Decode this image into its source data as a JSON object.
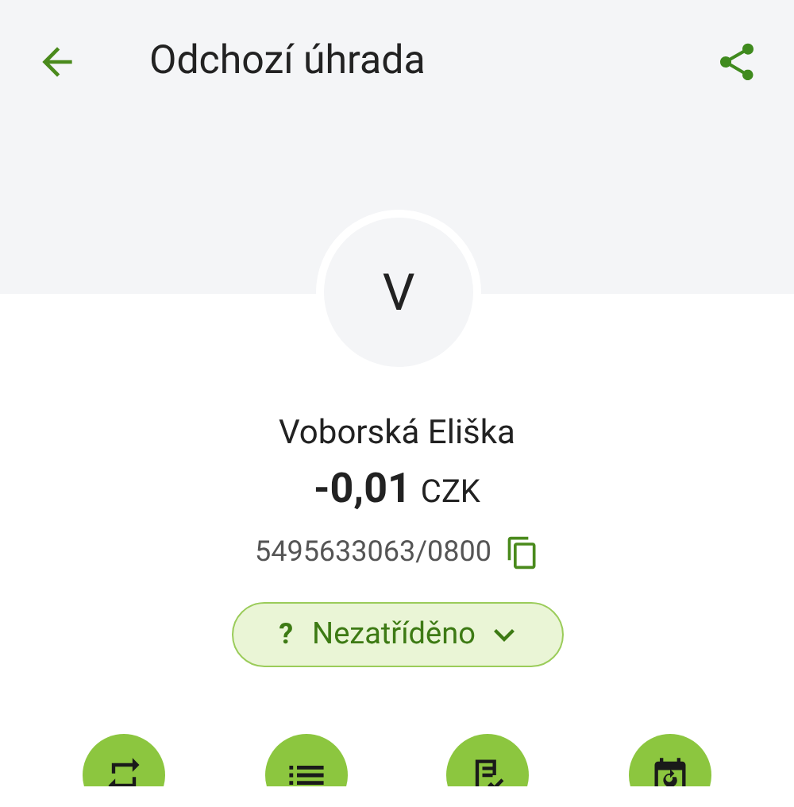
{
  "header": {
    "title": "Odchozí úhrada"
  },
  "avatar": {
    "initial": "V"
  },
  "counterparty": {
    "name": "Voborská Eliška",
    "amount": "-0,01",
    "currency": "CZK",
    "account": "5495633063/0800"
  },
  "category": {
    "mark": "?",
    "label": "Nezatříděno"
  },
  "actions": [
    {
      "kind": "repeat"
    },
    {
      "kind": "list"
    },
    {
      "kind": "note"
    },
    {
      "kind": "calendar"
    }
  ]
}
